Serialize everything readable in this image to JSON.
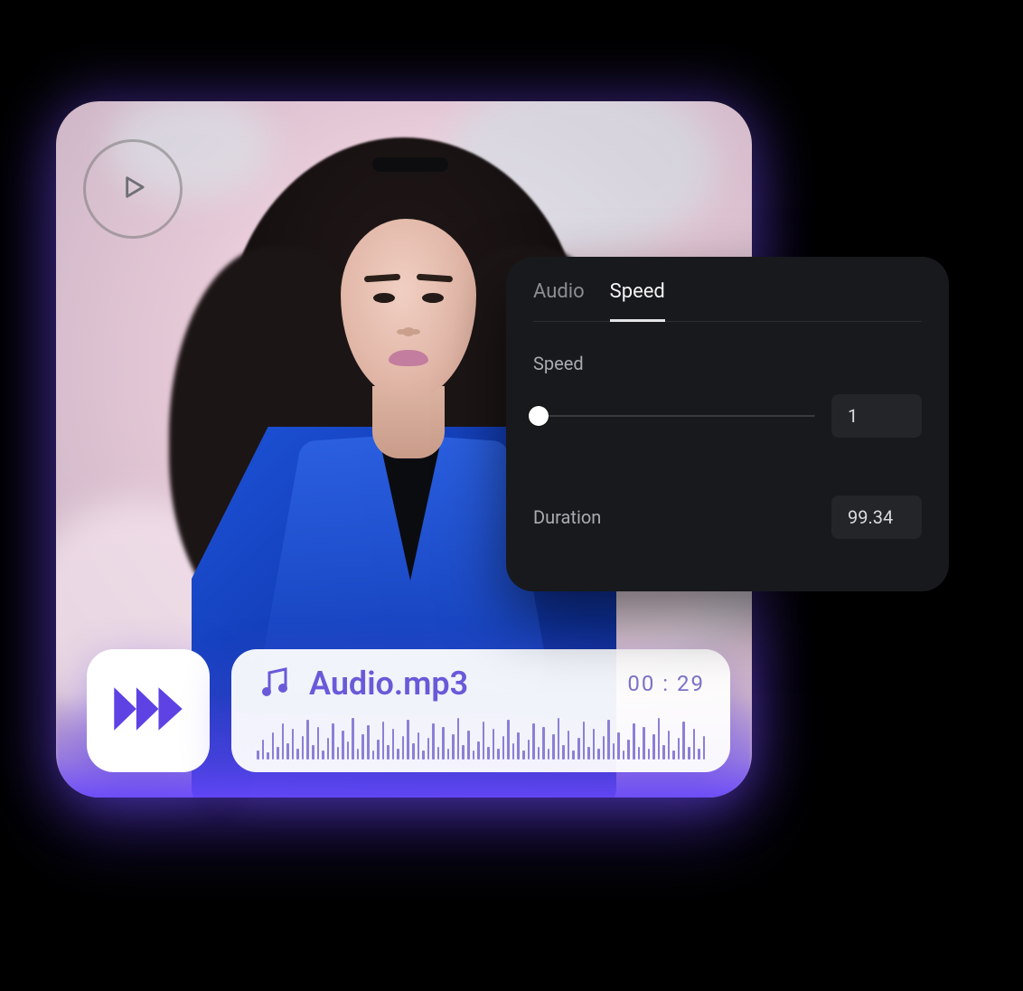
{
  "panel": {
    "tabs": {
      "audio": "Audio",
      "speed": "Speed",
      "active": "speed"
    },
    "speed_label": "Speed",
    "speed_value": "1",
    "duration_label": "Duration",
    "duration_value": "99.34"
  },
  "audio": {
    "filename": "Audio.mp3",
    "timestamp": "00 : 29"
  },
  "colors": {
    "accent": "#6a59d9",
    "panel_bg": "#18191c",
    "value_box": "#242529"
  },
  "waveform_heights": [
    10,
    22,
    8,
    30,
    14,
    40,
    18,
    34,
    12,
    26,
    44,
    16,
    36,
    10,
    24,
    40,
    14,
    32,
    20,
    46,
    12,
    28,
    38,
    10,
    22,
    42,
    16,
    34,
    12,
    26,
    44,
    18,
    30,
    10,
    24,
    40,
    14,
    36,
    12,
    28,
    46,
    16,
    32,
    10,
    20,
    42,
    14,
    34,
    12,
    26,
    44,
    18,
    30,
    10,
    22,
    40,
    14,
    36,
    12,
    28,
    46,
    16,
    32,
    10,
    24,
    42,
    14,
    34,
    12,
    26,
    44,
    18,
    30,
    10,
    22,
    40,
    14,
    36,
    12,
    28,
    46,
    16,
    32,
    10,
    24,
    42,
    14,
    34,
    12,
    26
  ]
}
